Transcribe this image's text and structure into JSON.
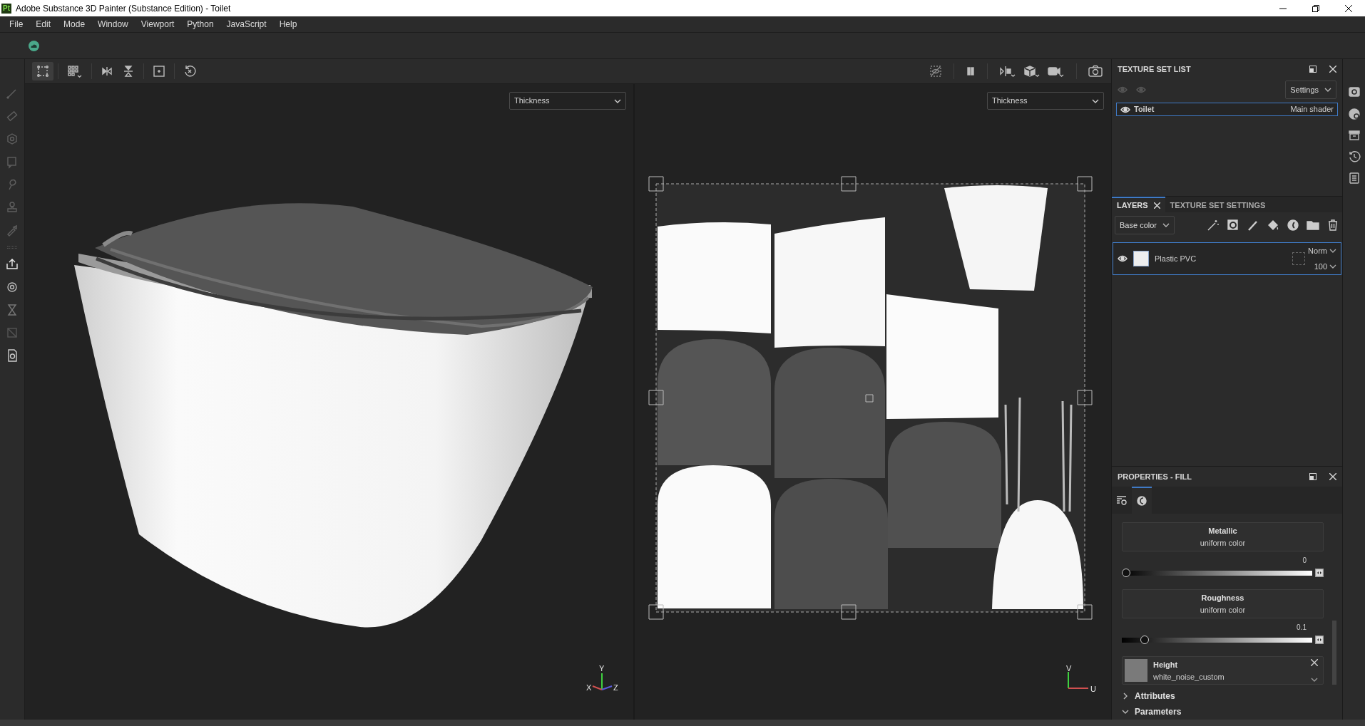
{
  "window": {
    "logo": "Pt",
    "title": "Adobe Substance 3D Painter (Substance Edition) - Toilet"
  },
  "menu": [
    "File",
    "Edit",
    "Mode",
    "Window",
    "Viewport",
    "Python",
    "JavaScript",
    "Help"
  ],
  "viewports": [
    {
      "kind": "model",
      "channel": "Thickness",
      "axes": [
        "Y",
        "X",
        "Z"
      ]
    },
    {
      "kind": "uv",
      "channel": "Thickness",
      "axes": [
        "V",
        "U"
      ]
    }
  ],
  "texture_set_list": {
    "title": "TEXTURE SET LIST",
    "settings": "Settings",
    "items": [
      {
        "name": "Toilet",
        "shader": "Main shader",
        "selected": true
      }
    ]
  },
  "layers_panel": {
    "tabs": [
      {
        "label": "LAYERS",
        "selected": true
      },
      {
        "label": "TEXTURE SET SETTINGS",
        "selected": false
      }
    ],
    "channel": "Base color",
    "layers": [
      {
        "name": "Plastic PVC",
        "blend": "Norm",
        "opacity": "100",
        "selected": true
      }
    ]
  },
  "properties": {
    "title": "PROPERTIES - FILL",
    "tabs": [
      {
        "kind": "settings",
        "selected": false
      },
      {
        "kind": "material",
        "selected": true
      }
    ],
    "channels": [
      {
        "kind": "slider",
        "name": "Metallic",
        "source": "uniform color",
        "reading": "0",
        "level": 0
      },
      {
        "kind": "slider",
        "name": "Roughness",
        "source": "uniform color",
        "reading": "0.1",
        "level": 0.1
      },
      {
        "kind": "resource",
        "name": "Height",
        "source": "white_noise_custom"
      }
    ],
    "sections": [
      {
        "label": "Attributes",
        "expanded": false
      },
      {
        "label": "Parameters",
        "expanded": true
      }
    ]
  }
}
